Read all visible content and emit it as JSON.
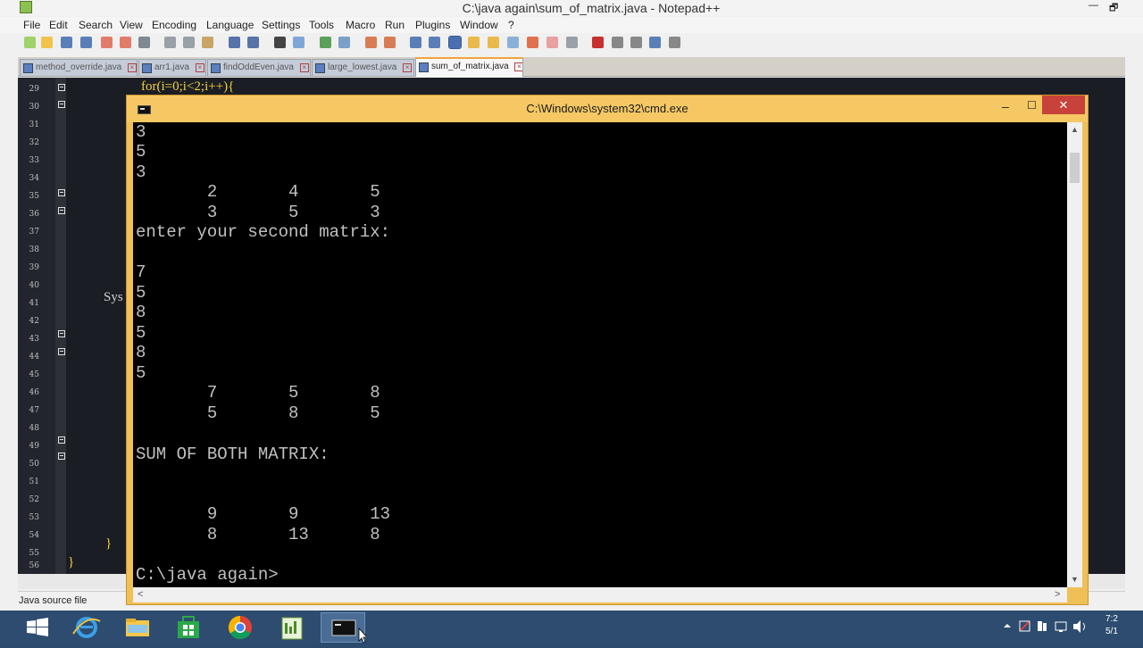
{
  "npp": {
    "title": "C:\\java again\\sum_of_matrix.java - Notepad++",
    "restore_glyph": "🗗",
    "min_glyph": "—",
    "menu": [
      "File",
      "Edit",
      "Search",
      "View",
      "Encoding",
      "Language",
      "Settings",
      "Tools",
      "Macro",
      "Run",
      "Plugins",
      "Window",
      "?"
    ],
    "tabs": [
      {
        "label": "method_override.java",
        "active": false
      },
      {
        "label": "arr1.java",
        "active": false
      },
      {
        "label": "findOddEven.java",
        "active": false
      },
      {
        "label": "large_lowest.java",
        "active": false
      },
      {
        "label": "sum_of_matrix.java",
        "active": true
      }
    ],
    "tab_close_glyph": "×",
    "line_numbers": [
      "29",
      "30",
      "31",
      "32",
      "33",
      "34",
      "35",
      "36",
      "37",
      "38",
      "39",
      "40",
      "41",
      "42",
      "43",
      "44",
      "45",
      "46",
      "47",
      "48",
      "49",
      "50",
      "51",
      "52",
      "53",
      "54",
      "55",
      "56"
    ],
    "code": {
      "line29": "for(i=0;i<2;i++){",
      "line41": "Sys",
      "line55": "}",
      "line56": "}"
    },
    "status_text": "Java source file"
  },
  "cmd": {
    "title": "C:\\Windows\\system32\\cmd.exe",
    "min_glyph": "–",
    "max_glyph": "☐",
    "close_glyph": "✕",
    "lines": [
      "3",
      "5",
      "3",
      "       2       4       5",
      "       3       5       3",
      "enter your second matrix:",
      "",
      "7",
      "5",
      "8",
      "5",
      "8",
      "5",
      "       7       5       8",
      "       5       8       5",
      "",
      "SUM OF BOTH MATRIX:",
      "",
      "",
      "       9       9       13",
      "       8       13      8",
      "",
      "C:\\java again>"
    ],
    "scroll_up": "▲",
    "scroll_down": "▼",
    "scroll_left": "<",
    "scroll_right": ">"
  },
  "taskbar": {
    "clock_time": "7:2",
    "clock_date": "5/1"
  }
}
